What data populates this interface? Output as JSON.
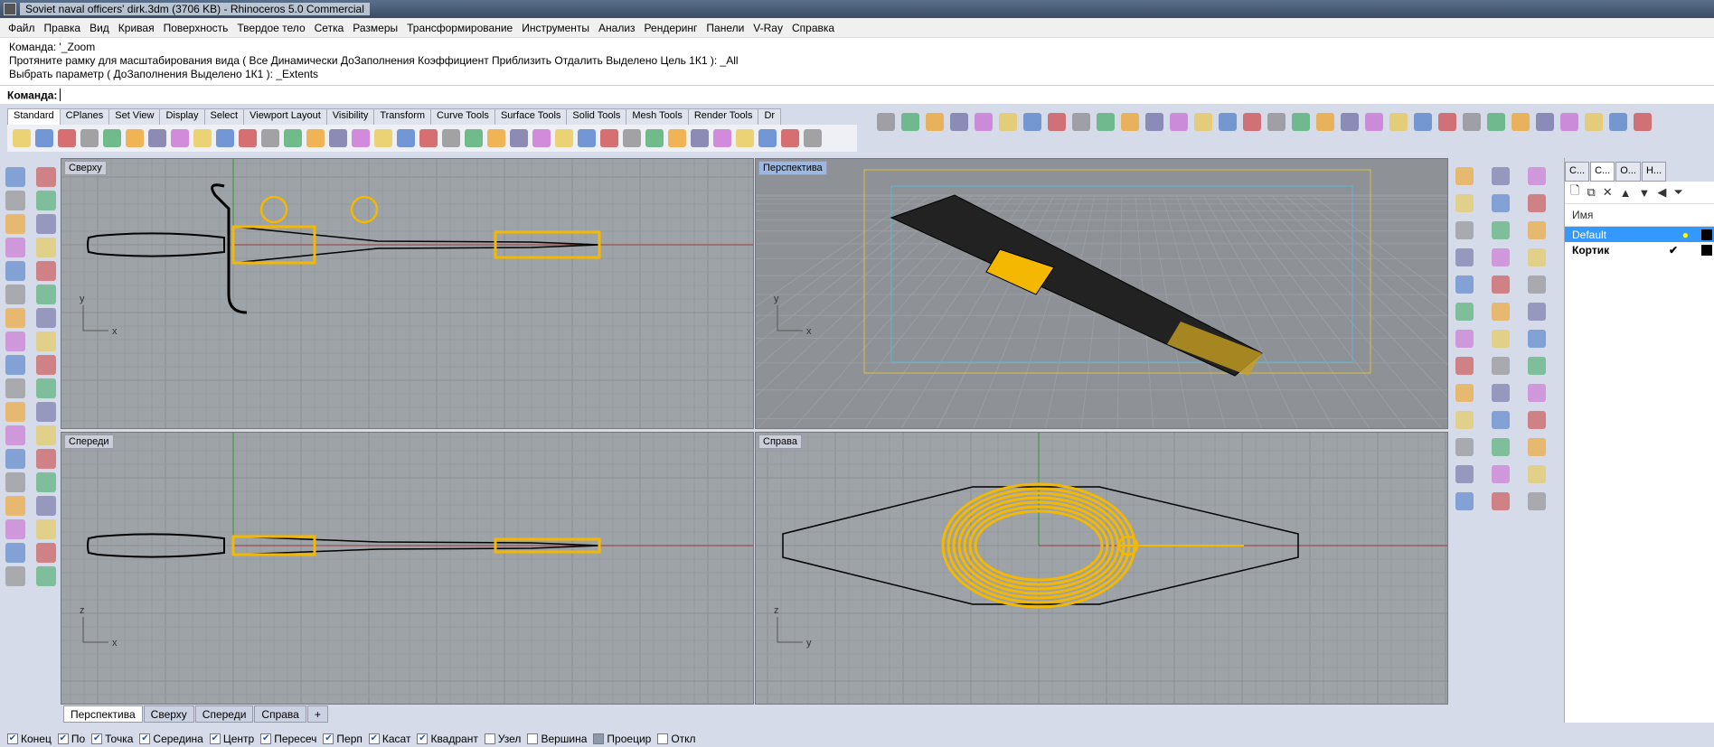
{
  "window": {
    "title": "Soviet naval officers' dirk.3dm (3706 KB) - Rhinoceros 5.0 Commercial"
  },
  "menu": [
    "Файл",
    "Правка",
    "Вид",
    "Кривая",
    "Поверхность",
    "Твердое тело",
    "Сетка",
    "Размеры",
    "Трансформирование",
    "Инструменты",
    "Анализ",
    "Рендеринг",
    "Панели",
    "V-Ray",
    "Справка"
  ],
  "command": {
    "history": [
      "Команда: '_Zoom",
      "Протяните рамку для масштабирования вида ( Все  Динамически  ДоЗаполнения  Коэффициент  Приблизить  Отдалить  Выделено  Цель  1К1 ): _All",
      "Выбрать параметр ( ДоЗаполнения  Выделено  1К1 ): _Extents"
    ],
    "prompt": "Команда:",
    "value": ""
  },
  "toolbar_tabs": [
    "Standard",
    "CPlanes",
    "Set View",
    "Display",
    "Select",
    "Viewport Layout",
    "Visibility",
    "Transform",
    "Curve Tools",
    "Surface Tools",
    "Solid Tools",
    "Mesh Tools",
    "Render Tools",
    "Dr"
  ],
  "viewports": {
    "top": "Сверху",
    "perspective": "Перспектива",
    "front": "Спереди",
    "right": "Справа"
  },
  "axes": {
    "x": "x",
    "y": "y",
    "z": "z"
  },
  "panel": {
    "tabs": [
      "C...",
      "C...",
      "O...",
      "H..."
    ],
    "column_name": "Имя",
    "layers": [
      {
        "name": "Default",
        "current": false,
        "selected": true
      },
      {
        "name": "Кортик",
        "current": true,
        "selected": false
      }
    ],
    "check": "✔"
  },
  "viewport_tabs": [
    "Перспектива",
    "Сверху",
    "Спереди",
    "Справа",
    "+"
  ],
  "osnaps": [
    {
      "label": "Конец",
      "on": true
    },
    {
      "label": "По",
      "on": true
    },
    {
      "label": "Точка",
      "on": true
    },
    {
      "label": "Середина",
      "on": true
    },
    {
      "label": "Центр",
      "on": true
    },
    {
      "label": "Пересеч",
      "on": true
    },
    {
      "label": "Перп",
      "on": true
    },
    {
      "label": "Касат",
      "on": true
    },
    {
      "label": "Квадрант",
      "on": true
    },
    {
      "label": "Узел",
      "on": false
    },
    {
      "label": "Вершина",
      "on": false
    },
    {
      "label": "Проецир",
      "on": false
    },
    {
      "label": "Откл",
      "on": false
    }
  ],
  "colors": {
    "selection": "#f5b800",
    "grid_bg": "#9ea3a8",
    "accent": "#3399ff"
  }
}
